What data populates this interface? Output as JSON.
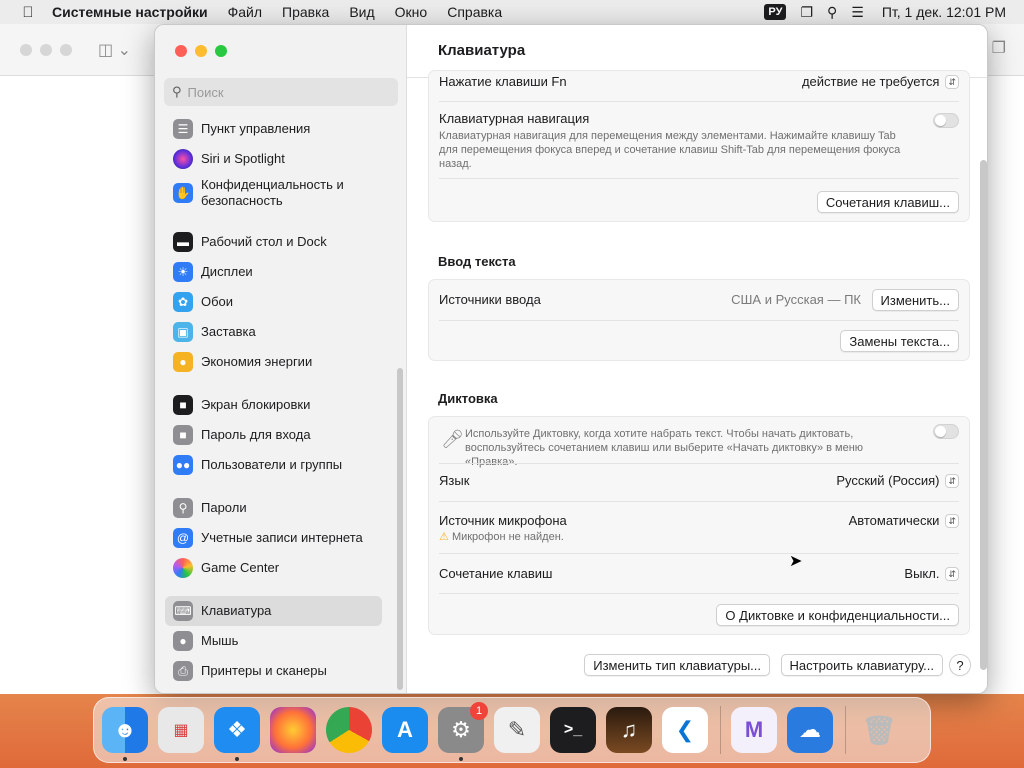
{
  "menubar": {
    "apple_icon": "apple-logo-icon",
    "app_name": "Системные настройки",
    "menus": [
      "Файл",
      "Правка",
      "Вид",
      "Окно",
      "Справка"
    ],
    "input_lang": "РУ",
    "clock": "Пт, 1 дек.  12:01 PM"
  },
  "sidebar": {
    "search_placeholder": "Поиск",
    "items": [
      {
        "label": "Пункт управления",
        "icon": "control-center-icon",
        "color": "#8e8e93"
      },
      {
        "label": "Siri и Spotlight",
        "icon": "siri-icon",
        "color": "#7b3fd6"
      },
      {
        "label": "Конфиденциальность и безопасность",
        "icon": "hand-icon",
        "color": "#2f7cf6"
      },
      {
        "label": "Рабочий стол и Dock",
        "icon": "dock-icon",
        "color": "#1d1d1f"
      },
      {
        "label": "Дисплеи",
        "icon": "sun-icon",
        "color": "#2f7cf6"
      },
      {
        "label": "Обои",
        "icon": "flower-icon",
        "color": "#33a3f0"
      },
      {
        "label": "Заставка",
        "icon": "screensaver-icon",
        "color": "#4cb4e8"
      },
      {
        "label": "Экономия энергии",
        "icon": "bulb-icon",
        "color": "#f5b324"
      },
      {
        "label": "Экран блокировки",
        "icon": "lock-icon",
        "color": "#1d1d1f"
      },
      {
        "label": "Пароль для входа",
        "icon": "lock-gray-icon",
        "color": "#8e8e93"
      },
      {
        "label": "Пользователи и группы",
        "icon": "users-icon",
        "color": "#2f7cf6"
      },
      {
        "label": "Пароли",
        "icon": "key-icon",
        "color": "#8e8e93"
      },
      {
        "label": "Учетные записи интернета",
        "icon": "at-icon",
        "color": "#2f7cf6"
      },
      {
        "label": "Game Center",
        "icon": "game-center-icon",
        "color": "#ffffff"
      },
      {
        "label": "Клавиатура",
        "icon": "keyboard-icon",
        "color": "#8e8e93"
      },
      {
        "label": "Мышь",
        "icon": "mouse-icon",
        "color": "#8e8e93"
      },
      {
        "label": "Принтеры и сканеры",
        "icon": "printer-icon",
        "color": "#8e8e93"
      }
    ]
  },
  "content": {
    "title": "Клавиатура",
    "fn_label": "Нажатие клавиши Fn",
    "fn_value": "действие не требуется",
    "kbnav_label": "Клавиатурная навигация",
    "kbnav_desc": "Клавиатурная навигация для перемещения между элементами. Нажимайте клавишу Tab для перемещения фокуса вперед и сочетание клавиш Shift-Tab для перемещения фокуса назад.",
    "shortcuts_button": "Сочетания клавиш...",
    "text_input_heading": "Ввод текста",
    "input_sources_label": "Источники ввода",
    "input_sources_value": "США и Русская — ПК",
    "change_button": "Изменить...",
    "text_replacements_button": "Замены текста...",
    "dictation_heading": "Диктовка",
    "dictation_desc": "Используйте Диктовку, когда хотите набрать текст. Чтобы начать диктовать, воспользуйтесь сочетанием клавиш или выберите «Начать диктовку» в меню «Правка».",
    "language_label": "Язык",
    "language_value": "Русский (Россия)",
    "mic_label": "Источник микрофона",
    "mic_value": "Автоматически",
    "mic_warning": "Микрофон не найден.",
    "shortcut_label": "Сочетание клавиш",
    "shortcut_value": "Выкл.",
    "about_dictation_button": "О Диктовке и конфиденциальности...",
    "change_kb_type_button": "Изменить тип клавиатуры...",
    "setup_kb_button": "Настроить клавиатуру...",
    "help_button": "?"
  },
  "dock": {
    "apps": [
      {
        "name": "Finder",
        "icon": "finder-icon",
        "color": "#2b8ef0",
        "running": true
      },
      {
        "name": "Launchpad",
        "icon": "launchpad-icon",
        "color": "#e8e8e8",
        "running": false
      },
      {
        "name": "Safari",
        "icon": "safari-icon",
        "color": "#1e8cf0",
        "running": true
      },
      {
        "name": "Firefox",
        "icon": "firefox-icon",
        "color": "#ff7139",
        "running": false
      },
      {
        "name": "Chrome",
        "icon": "chrome-icon",
        "color": "#ffffff",
        "running": false
      },
      {
        "name": "App Store",
        "icon": "app-store-icon",
        "color": "#1a8cf0",
        "running": false
      },
      {
        "name": "Системные настройки",
        "icon": "system-settings-icon",
        "color": "#8a8a8a",
        "running": true,
        "badge": "1"
      },
      {
        "name": "TextEdit",
        "icon": "script-editor-icon",
        "color": "#f0f0f0",
        "running": false
      },
      {
        "name": "Terminal",
        "icon": "terminal-icon",
        "color": "#1d1d1f",
        "running": false
      },
      {
        "name": "Instruments",
        "icon": "guitar-icon",
        "color": "#5a3a1e",
        "running": false
      },
      {
        "name": "VS Code",
        "icon": "vscode-icon",
        "color": "#ffffff",
        "running": false
      },
      {
        "name": "Visual Studio",
        "icon": "visual-studio-icon",
        "color": "#f4f0fb",
        "running": false
      },
      {
        "name": "Weather",
        "icon": "weather-icon",
        "color": "#2a7be0",
        "running": false
      },
      {
        "name": "Trash",
        "icon": "trash-icon",
        "color": "#e6e6e6",
        "running": false
      }
    ]
  }
}
